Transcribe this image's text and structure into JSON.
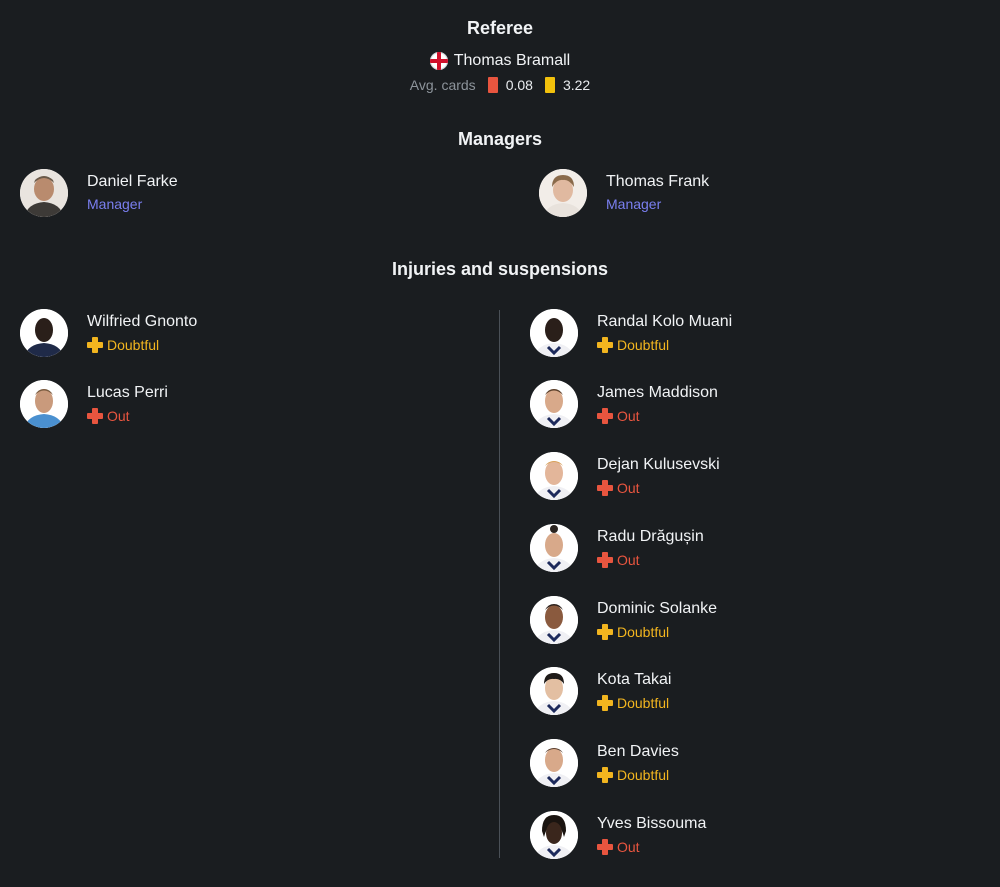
{
  "referee": {
    "title": "Referee",
    "flag_icon": "england-flag-icon",
    "name": "Thomas Bramall",
    "avg_cards_label": "Avg. cards",
    "red_avg": "0.08",
    "yellow_avg": "3.22",
    "red_color": "#e8553f",
    "yellow_color": "#f2c10c"
  },
  "managers": {
    "title": "Managers",
    "home": {
      "name": "Daniel Farke",
      "role": "Manager"
    },
    "away": {
      "name": "Thomas Frank",
      "role": "Manager"
    }
  },
  "injuries": {
    "title": "Injuries and suspensions",
    "home": [
      {
        "name": "Wilfried Gnonto",
        "status": "Doubtful"
      },
      {
        "name": "Lucas Perri",
        "status": "Out"
      }
    ],
    "away": [
      {
        "name": "Randal Kolo Muani",
        "status": "Doubtful"
      },
      {
        "name": "James Maddison",
        "status": "Out"
      },
      {
        "name": "Dejan Kulusevski",
        "status": "Out"
      },
      {
        "name": "Radu Drăgușin",
        "status": "Out"
      },
      {
        "name": "Dominic Solanke",
        "status": "Doubtful"
      },
      {
        "name": "Kota Takai",
        "status": "Doubtful"
      },
      {
        "name": "Ben Davies",
        "status": "Doubtful"
      },
      {
        "name": "Yves Bissouma",
        "status": "Out"
      }
    ]
  },
  "colors": {
    "background": "#1a1d20",
    "manager_role": "#7a7ff0",
    "doubtful": "#f2b51f",
    "out": "#e8553f"
  }
}
